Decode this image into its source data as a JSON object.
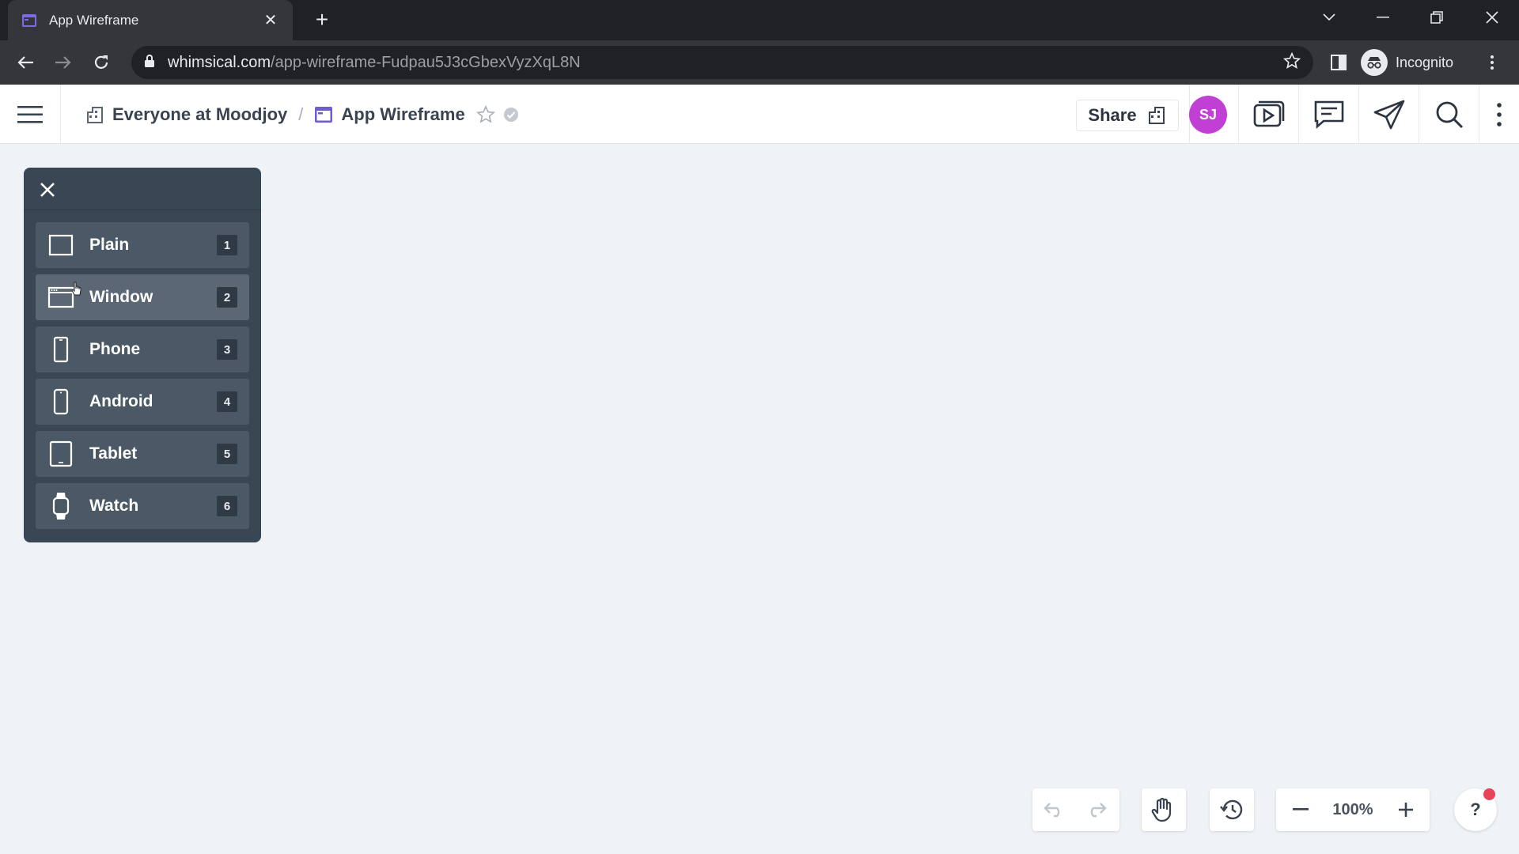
{
  "browser": {
    "tab_title": "App Wireframe",
    "url_host": "whimsical.com",
    "url_path": "/app-wireframe-Fudpau5J3cGbexVyzXqL8N",
    "profile_label": "Incognito"
  },
  "header": {
    "workspace": "Everyone at Moodjoy",
    "separator": "/",
    "doc_title": "App Wireframe",
    "share_label": "Share",
    "avatar_initials": "SJ",
    "avatar_color": "#c23fd6"
  },
  "frames_panel": {
    "items": [
      {
        "label": "Plain",
        "key": "1",
        "icon": "rectangle-icon"
      },
      {
        "label": "Window",
        "key": "2",
        "icon": "browser-window-icon"
      },
      {
        "label": "Phone",
        "key": "3",
        "icon": "phone-icon"
      },
      {
        "label": "Android",
        "key": "4",
        "icon": "android-phone-icon"
      },
      {
        "label": "Tablet",
        "key": "5",
        "icon": "tablet-icon"
      },
      {
        "label": "Watch",
        "key": "6",
        "icon": "watch-icon"
      }
    ]
  },
  "toolbar": {
    "zoom": "100%",
    "help_label": "?"
  },
  "colors": {
    "canvas": "#eff2f6",
    "panel": "#394654",
    "accent_purple": "#6e5bd6"
  }
}
